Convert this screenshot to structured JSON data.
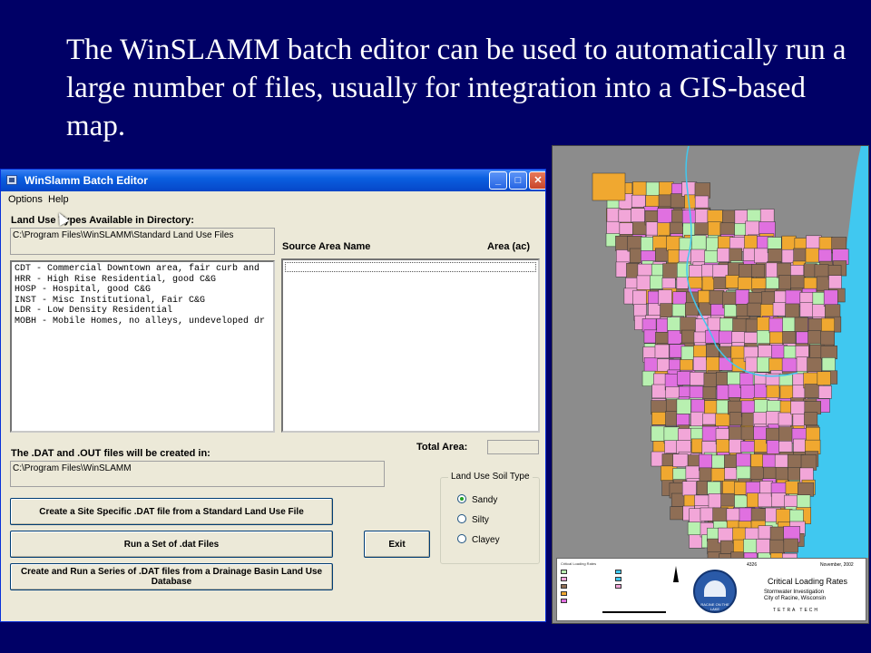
{
  "slide": {
    "title": "The WinSLAMM batch editor can be used to automatically run a large number of files, usually for integration into a GIS-based map."
  },
  "window": {
    "title": "WinSlamm Batch Editor",
    "controls": {
      "minimize": "_",
      "maximize": "□",
      "close": "✕"
    },
    "menu": [
      "Options",
      "Help"
    ]
  },
  "land_use": {
    "label": "Land Use Types Available in Directory:",
    "directory": "C:\\Program Files\\WinSLAMM\\Standard Land Use Files",
    "items": [
      "CDT - Commercial Downtown area, fair curb and",
      "HRR - High Rise Residential, good C&G",
      "HOSP - Hospital, good C&G",
      "INST - Misc Institutional, Fair C&G",
      "LDR - Low Density Residential",
      "MOBH - Mobile Homes, no alleys, undeveloped dr"
    ]
  },
  "source_area": {
    "name_header": "Source Area Name",
    "area_header": "Area (ac)"
  },
  "output": {
    "label": "The .DAT and .OUT files will be created in:",
    "path": "C:\\Program Files\\WinSLAMM"
  },
  "total_area": {
    "label": "Total Area:",
    "value": ""
  },
  "soil_type": {
    "caption": "Land Use Soil Type",
    "options": [
      "Sandy",
      "Silty",
      "Clayey"
    ],
    "selected": "Sandy"
  },
  "buttons": {
    "create_site": "Create a Site Specific .DAT file from a Standard Land Use File",
    "run_set": "Run a Set of .dat Files",
    "exit": "Exit",
    "create_run_series": "Create and Run a Series of .DAT files from a Drainage Basin Land Use Database"
  },
  "map": {
    "title": "Critical Loading Rates",
    "date": "November, 2002",
    "code": "4326",
    "subtitle_line1": "Stormwater Investigation",
    "subtitle_line2": "City of Racine, Wisconsin",
    "logo_text": "RACINE ON THE LAKE",
    "consultant": "TETRA TECH",
    "legend_title": "Critical Loading Rates",
    "colors": {
      "pink": "#f2a6d8",
      "brown": "#8f6e55",
      "green": "#b8f0b0",
      "orange": "#f0a830",
      "magenta": "#e070e0",
      "water": "#40c8f0",
      "background": "#8c8c8c"
    }
  }
}
